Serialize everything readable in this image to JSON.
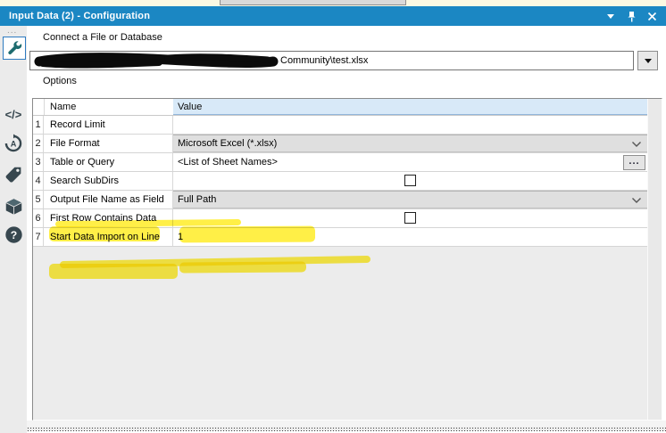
{
  "panel": {
    "title": "Input Data (2) - Configuration",
    "titlebar_color": "#1B87C3",
    "highlight_color": "#FFE900",
    "value_header_color": "#D8E9F8"
  },
  "titlebar": {
    "icons": [
      "dropdown-arrow",
      "pin",
      "close"
    ]
  },
  "sidebar": {
    "items": [
      {
        "icon": "wrench-icon",
        "label": "configuration",
        "selected": true
      },
      {
        "icon": "code-brackets-icon",
        "label": "metadata",
        "selected": false,
        "glyph": "</>"
      },
      {
        "icon": "circular-arrow-a-icon",
        "label": "annotation",
        "selected": false,
        "letter": "A"
      },
      {
        "icon": "tag-icon",
        "label": "tag",
        "selected": false
      },
      {
        "icon": "package-icon",
        "label": "package",
        "selected": false
      },
      {
        "icon": "help-icon",
        "label": "help",
        "selected": false,
        "glyph": "?"
      }
    ]
  },
  "connect": {
    "label": "Connect a File or Database",
    "path_visible": "Community\\test.xlsx",
    "path_redacted": true
  },
  "options": {
    "label": "Options",
    "table": {
      "headers": {
        "name": "Name",
        "value": "Value"
      },
      "rows": [
        {
          "num": "1",
          "name": "Record Limit",
          "value": "",
          "type": "text"
        },
        {
          "num": "2",
          "name": "File Format",
          "value": "Microsoft Excel (*.xlsx)",
          "type": "dropdown"
        },
        {
          "num": "3",
          "name": "Table or Query",
          "value": "<List of Sheet Names>",
          "type": "browse",
          "highlighted": true,
          "browse_label": "..."
        },
        {
          "num": "4",
          "name": "Search SubDirs",
          "value": "",
          "type": "checkbox",
          "checked": false
        },
        {
          "num": "5",
          "name": "Output File Name as Field",
          "value": "Full Path",
          "type": "dropdown",
          "highlighted": true
        },
        {
          "num": "6",
          "name": "First Row Contains Data",
          "value": "",
          "type": "checkbox",
          "checked": false
        },
        {
          "num": "7",
          "name": "Start Data Import on Line",
          "value": "1",
          "type": "text"
        }
      ]
    }
  }
}
